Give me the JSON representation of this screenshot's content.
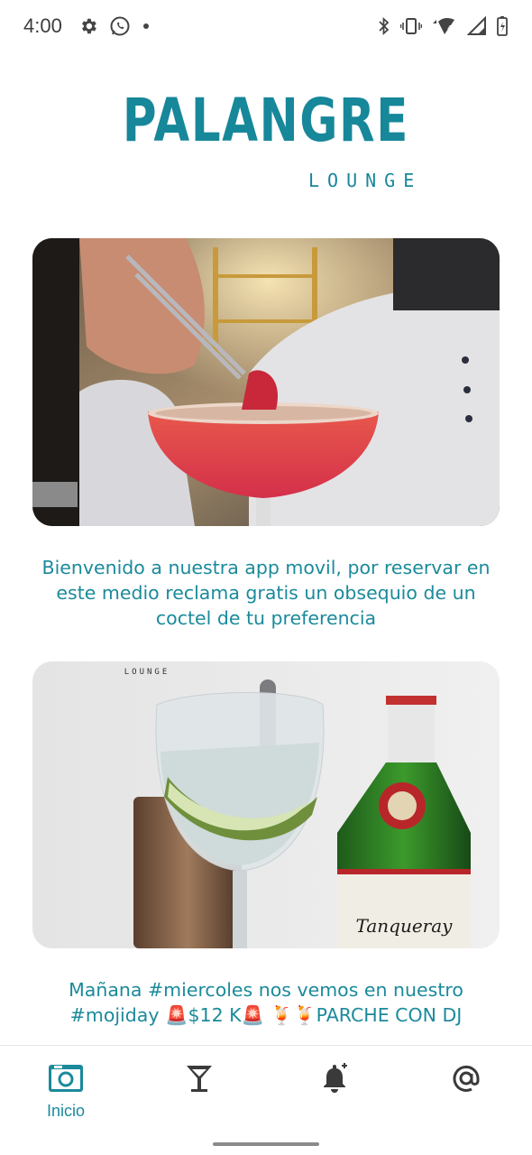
{
  "status_bar": {
    "time": "4:00",
    "left_icons": [
      "gear-icon",
      "whatsapp-icon",
      "dot-icon"
    ],
    "right_icons": [
      "bluetooth-icon",
      "vibrate-icon",
      "wifi-icon",
      "signal-icon",
      "battery-icon"
    ]
  },
  "logo": {
    "main": "PALANGRE",
    "sub": "LOUNGE"
  },
  "feed": {
    "posts": [
      {
        "image": "cocktail-strawberry-margarita",
        "text": "Bienvenido a nuestra app movil, por reservar en este medio reclama gratis un obsequio de un coctel de tu preferencia"
      },
      {
        "image": "gin-tonic-tanqueray",
        "image_overlay_text": "LOUNGE",
        "bottle_label": "Tanqueray",
        "text": "Mañana #miercoles nos vemos en nuestro #mojiday 🚨$12 K🚨 🍹🍹PARCHE CON DJ"
      }
    ]
  },
  "bottom_nav": {
    "items": [
      {
        "label": "Inicio",
        "icon": "camera-icon",
        "active": true
      },
      {
        "label": "",
        "icon": "cocktail-glass-icon",
        "active": false
      },
      {
        "label": "",
        "icon": "bell-add-icon",
        "active": false
      },
      {
        "label": "",
        "icon": "at-sign-icon",
        "active": false
      }
    ]
  },
  "colors": {
    "accent": "#17879a",
    "text_teal": "#1b8a9b",
    "inactive_icon": "#3a3a3a"
  }
}
